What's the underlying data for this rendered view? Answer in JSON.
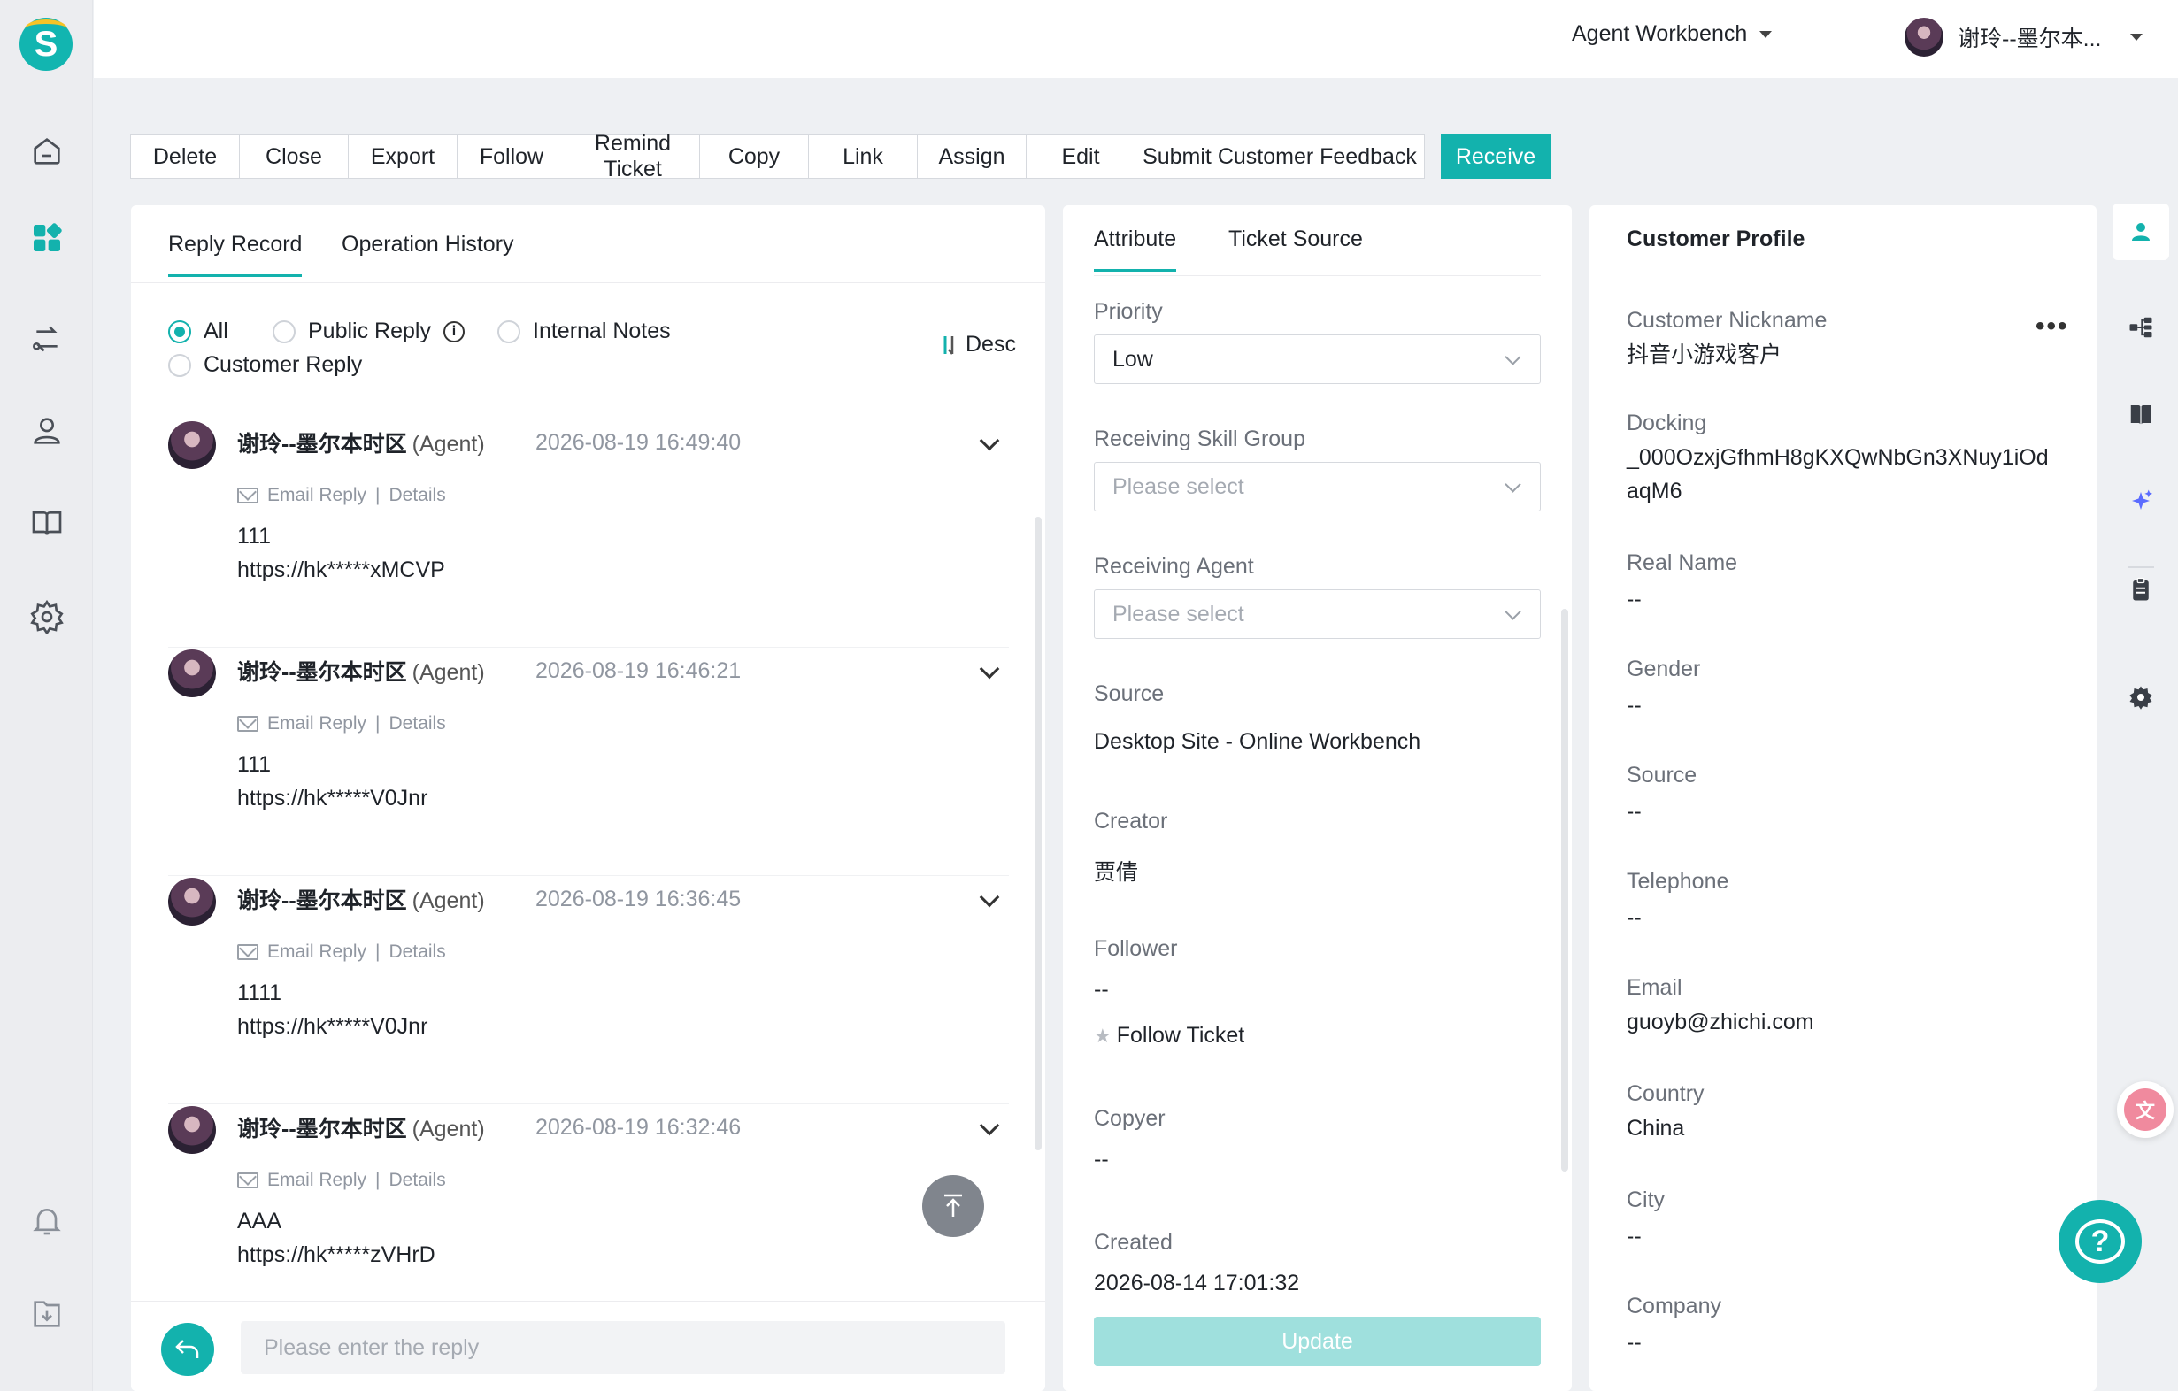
{
  "app": {
    "logo_letter": "S",
    "brand_color": "#13b2ad"
  },
  "topbar": {
    "workbench_label": "Agent Workbench",
    "user_name": "谢玲--墨尔本..."
  },
  "toolbar": {
    "buttons": [
      "Delete",
      "Close",
      "Export",
      "Follow",
      "Remind Ticket",
      "Copy",
      "Link",
      "Assign",
      "Edit",
      "Submit Customer Feedback"
    ],
    "receive_label": "Receive"
  },
  "records_panel": {
    "tabs": [
      "Reply Record",
      "Operation History"
    ],
    "filters": {
      "all": "All",
      "public_reply": "Public Reply",
      "internal_notes": "Internal Notes",
      "customer_reply": "Customer Reply",
      "selected": "All"
    },
    "sort_label": "Desc",
    "replies": [
      {
        "name": "谢玲--墨尔本时区",
        "role": "(Agent)",
        "time": "2026-08-19 16:49:40",
        "type": "Email Reply",
        "details": "Details",
        "line1": "111",
        "line2": "https://hk*****xMCVP"
      },
      {
        "name": "谢玲--墨尔本时区",
        "role": "(Agent)",
        "time": "2026-08-19 16:46:21",
        "type": "Email Reply",
        "details": "Details",
        "line1": "111",
        "line2": "https://hk*****V0Jnr"
      },
      {
        "name": "谢玲--墨尔本时区",
        "role": "(Agent)",
        "time": "2026-08-19 16:36:45",
        "type": "Email Reply",
        "details": "Details",
        "line1": "1111",
        "line2": "https://hk*****V0Jnr"
      },
      {
        "name": "谢玲--墨尔本时区",
        "role": "(Agent)",
        "time": "2026-08-19 16:32:46",
        "type": "Email Reply",
        "details": "Details",
        "line1": "AAA",
        "line2": "https://hk*****zVHrD"
      }
    ],
    "reply_placeholder": "Please enter the reply"
  },
  "attribute_panel": {
    "tabs": [
      "Attribute",
      "Ticket Source"
    ],
    "priority_label": "Priority",
    "priority_value": "Low",
    "skill_group_label": "Receiving Skill Group",
    "skill_group_placeholder": "Please select",
    "agent_label": "Receiving Agent",
    "agent_placeholder": "Please select",
    "source_label": "Source",
    "source_value": "Desktop Site - Online Workbench",
    "creator_label": "Creator",
    "creator_value": "贾倩",
    "follower_label": "Follower",
    "follower_value": "--",
    "follow_ticket": "Follow Ticket",
    "copyer_label": "Copyer",
    "copyer_value": "--",
    "created_label": "Created",
    "created_value": "2026-08-14 17:01:32",
    "update_label": "Update"
  },
  "customer_profile": {
    "title": "Customer Profile",
    "fields": [
      {
        "label": "Customer Nickname",
        "value": "抖音小游戏客户"
      },
      {
        "label": "Docking",
        "value": "_000OzxjGfhmH8gKXQwNbGn3XNuy1iOdaqM6"
      },
      {
        "label": "Real Name",
        "value": "--"
      },
      {
        "label": "Gender",
        "value": "--"
      },
      {
        "label": "Source",
        "value": "--"
      },
      {
        "label": "Telephone",
        "value": "--"
      },
      {
        "label": "Email",
        "value": "guoyb@zhichi.com"
      },
      {
        "label": "Country",
        "value": "China"
      },
      {
        "label": "City",
        "value": "--"
      },
      {
        "label": "Company",
        "value": "--"
      }
    ]
  },
  "icons": {
    "left_nav": [
      "home-icon",
      "workbench-icon",
      "routing-icon",
      "customer-icon",
      "knowledge-book-icon",
      "settings-icon",
      "bell-icon",
      "download-icon"
    ],
    "right_rail": [
      "user-profile-icon",
      "hierarchy-icon",
      "book-icon",
      "ai-sparkle-icon",
      "clipboard-icon",
      "gear-icon"
    ]
  }
}
